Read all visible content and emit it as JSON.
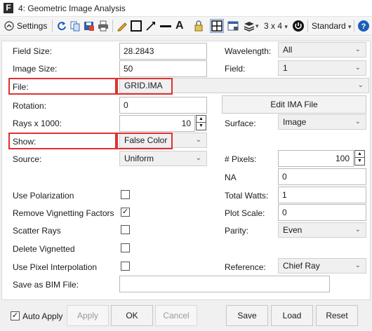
{
  "window": {
    "app_icon_letter": "F",
    "title": "4: Geometric Image Analysis"
  },
  "toolbar": {
    "settings_label": "Settings",
    "layout": "3 x 4",
    "layout_arrow": "▾",
    "standard": "Standard"
  },
  "form": {
    "field_size": {
      "label": "Field Size:",
      "value": "28.2843"
    },
    "image_size": {
      "label": "Image Size:",
      "value": "50"
    },
    "file": {
      "label": "File:",
      "value": "GRID.IMA"
    },
    "rotation": {
      "label": "Rotation:",
      "value": "0"
    },
    "rays": {
      "label": "Rays x 1000:",
      "value": "10"
    },
    "show": {
      "label": "Show:",
      "value": "False Color"
    },
    "source": {
      "label": "Source:",
      "value": "Uniform"
    },
    "wavelength": {
      "label": "Wavelength:",
      "value": "All"
    },
    "field": {
      "label": "Field:",
      "value": "1"
    },
    "edit_ima": "Edit IMA File",
    "surface": {
      "label": "Surface:",
      "value": "Image"
    },
    "pixels": {
      "label": "# Pixels:",
      "value": "100"
    },
    "na": {
      "label": "NA",
      "value": "0"
    },
    "total_watts": {
      "label": "Total Watts:",
      "value": "1"
    },
    "plot_scale": {
      "label": "Plot Scale:",
      "value": "0"
    },
    "parity": {
      "label": "Parity:",
      "value": "Even"
    },
    "reference": {
      "label": "Reference:",
      "value": "Chief Ray"
    },
    "use_polarization": {
      "label": "Use Polarization",
      "checked": false
    },
    "remove_vignetting": {
      "label": "Remove Vignetting Factors",
      "checked": true
    },
    "scatter_rays": {
      "label": "Scatter Rays",
      "checked": false
    },
    "delete_vignetted": {
      "label": "Delete Vignetted",
      "checked": false
    },
    "pixel_interp": {
      "label": "Use Pixel Interpolation",
      "checked": false
    },
    "save_bim": {
      "label": "Save as BIM File:",
      "value": ""
    }
  },
  "footer": {
    "auto_apply": {
      "label": "Auto Apply",
      "checked": true
    },
    "apply": "Apply",
    "ok": "OK",
    "cancel": "Cancel",
    "save": "Save",
    "load": "Load",
    "reset": "Reset"
  },
  "glyphs": {
    "check": "✓",
    "dropdown": "⌄",
    "spin_up": "▲",
    "spin_down": "▼"
  },
  "colors": {
    "highlight": "#e03131",
    "accent_blue": "#1c5fb8"
  }
}
